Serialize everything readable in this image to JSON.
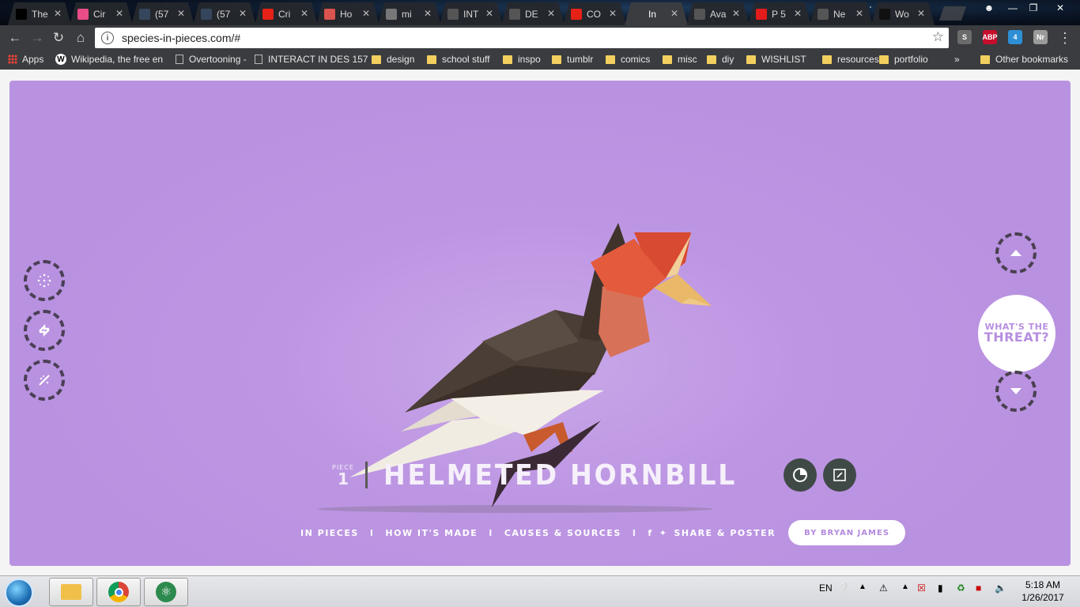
{
  "tabs": [
    {
      "label": "The",
      "favicon": "m-logo-icon",
      "color": "#000000"
    },
    {
      "label": "Cir",
      "favicon": "dribbble-icon",
      "color": "#ea4c89"
    },
    {
      "label": "(57",
      "favicon": "tumblr-icon",
      "color": "#35465c"
    },
    {
      "label": "(57",
      "favicon": "tumblr-icon",
      "color": "#35465c"
    },
    {
      "label": "Cri",
      "favicon": "youtube-icon",
      "color": "#e62117"
    },
    {
      "label": "Ho",
      "favicon": "page-icon",
      "color": "#d9534f"
    },
    {
      "label": "mi",
      "favicon": "avatar-icon",
      "color": "#777777"
    },
    {
      "label": "INT",
      "favicon": "page-icon",
      "color": "#555555"
    },
    {
      "label": "DE",
      "favicon": "page-icon",
      "color": "#555555"
    },
    {
      "label": "CO",
      "favicon": "youtube-icon",
      "color": "#e62117"
    },
    {
      "label": "In",
      "favicon": "species-icon",
      "color": "#3a3c40",
      "active": true
    },
    {
      "label": "Ava",
      "favicon": "page-icon",
      "color": "#555555"
    },
    {
      "label": "P 5",
      "favicon": "adobe-icon",
      "color": "#e21b1b"
    },
    {
      "label": "Ne",
      "favicon": "page-icon",
      "color": "#555555"
    },
    {
      "label": "Wo",
      "favicon": "tm-icon",
      "color": "#111111"
    }
  ],
  "address": {
    "url": "species-in-pieces.com/#"
  },
  "extensions": [
    {
      "label": "S",
      "color": "#6b6b6b"
    },
    {
      "label": "ABP",
      "color": "#c70d2c"
    },
    {
      "label": "4",
      "color": "#2d8fd5"
    },
    {
      "label": "Nr",
      "color": "#9a9a9a"
    }
  ],
  "bookmarks": [
    {
      "label": "Apps",
      "kind": "apps"
    },
    {
      "label": "Wikipedia, the free en",
      "kind": "wiki"
    },
    {
      "label": "Overtooning -",
      "kind": "page"
    },
    {
      "label": "INTERACT IN DES 157",
      "kind": "page"
    },
    {
      "label": "design",
      "kind": "folder"
    },
    {
      "label": "school stuff",
      "kind": "folder"
    },
    {
      "label": "inspo",
      "kind": "folder"
    },
    {
      "label": "tumblr",
      "kind": "folder"
    },
    {
      "label": "comics",
      "kind": "folder"
    },
    {
      "label": "misc",
      "kind": "folder"
    },
    {
      "label": "diy",
      "kind": "folder"
    },
    {
      "label": "WISHLIST",
      "kind": "folder"
    },
    {
      "label": "resources",
      "kind": "folder"
    },
    {
      "label": "portfolio",
      "kind": "folder"
    },
    {
      "label": "»",
      "kind": "overflow"
    },
    {
      "label": "Other bookmarks",
      "kind": "folder"
    }
  ],
  "species": {
    "piece_label": "PIECE",
    "piece_number": "1",
    "name": "HELMETED HORNBILL",
    "threat_line1": "WHAT'S THE",
    "threat_line2": "THREAT?"
  },
  "footer": {
    "in_pieces": "IN PIECES",
    "how_made": "HOW IT'S MADE",
    "causes": "CAUSES & SOURCES",
    "share": "SHARE & POSTER",
    "byline": "BY BRYAN JAMES",
    "sep": "I"
  },
  "colors": {
    "background": "#b891e0",
    "accent_white": "#ffffff",
    "button_dark": "#3f4a47"
  },
  "taskbar": {
    "language": "EN",
    "time": "5:18 AM",
    "date": "1/26/2017"
  }
}
